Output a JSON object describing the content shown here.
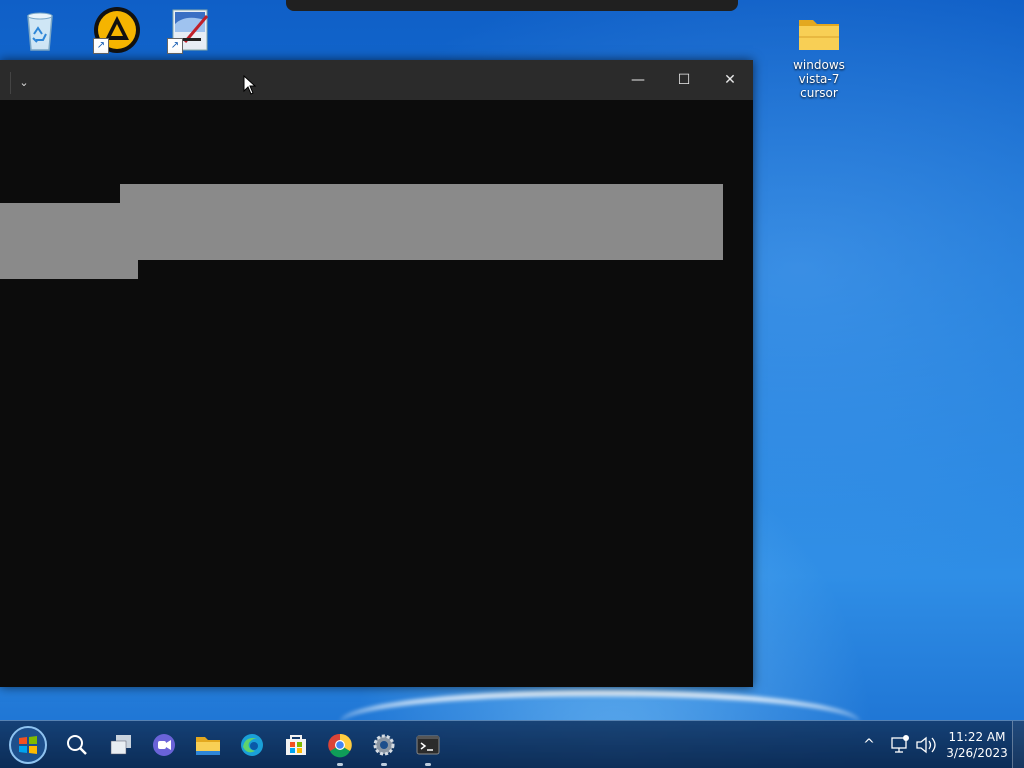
{
  "desktop": {
    "icons": [
      {
        "name": "Recycle Bin",
        "label": "",
        "icon": "recycle-bin-icon"
      },
      {
        "name": "AIMP",
        "label": "",
        "icon": "aimp-icon",
        "shortcut": true
      },
      {
        "name": "Paint tool",
        "label": "",
        "icon": "paint-icon",
        "shortcut": true
      },
      {
        "name": "folder",
        "label_line1": "windows",
        "label_line2": "vista-7 cursor",
        "icon": "folder-icon"
      }
    ],
    "shortcut_glyph": "↗"
  },
  "window": {
    "tab_dropdown": "⌄",
    "minimize": "—",
    "maximize": "☐",
    "close": "✕",
    "background": "#0c0c0c",
    "titlebar_color": "#2b2b2b"
  },
  "taskbar": {
    "items": [
      {
        "icon": "start-orb-icon"
      },
      {
        "icon": "search-icon"
      },
      {
        "icon": "task-view-icon"
      },
      {
        "icon": "chat-icon"
      },
      {
        "icon": "file-explorer-icon"
      },
      {
        "icon": "edge-icon"
      },
      {
        "icon": "store-icon"
      },
      {
        "icon": "chrome-icon",
        "running": true
      },
      {
        "icon": "settings-icon",
        "running": true
      },
      {
        "icon": "terminal-icon",
        "running": true
      }
    ],
    "tray": {
      "chevron": "^",
      "network_icon": "network-icon",
      "volume_icon": "volume-icon"
    },
    "clock": {
      "time": "11:22 AM",
      "date": "3/26/2023"
    }
  }
}
